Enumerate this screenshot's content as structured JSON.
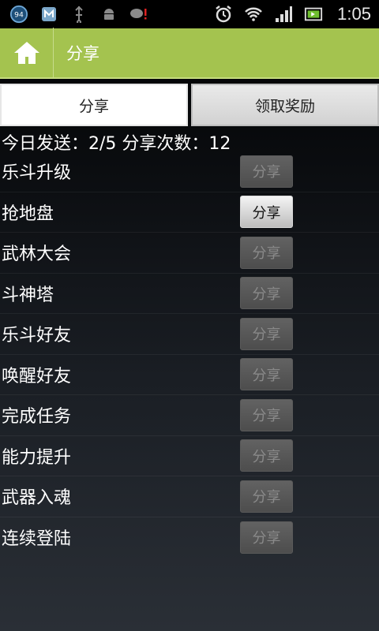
{
  "status_bar": {
    "notification_badge": "94",
    "time": "1:05"
  },
  "header": {
    "title": "分享"
  },
  "tabs": [
    {
      "label": "分享",
      "active": true
    },
    {
      "label": "领取奖励",
      "active": false
    }
  ],
  "stats": {
    "text": "今日发送：2/5 分享次数：12"
  },
  "items": [
    {
      "label": "乐斗升级",
      "button": "分享",
      "enabled": false
    },
    {
      "label": "抢地盘",
      "button": "分享",
      "enabled": true
    },
    {
      "label": "武林大会",
      "button": "分享",
      "enabled": false
    },
    {
      "label": "斗神塔",
      "button": "分享",
      "enabled": false
    },
    {
      "label": "乐斗好友",
      "button": "分享",
      "enabled": false
    },
    {
      "label": "唤醒好友",
      "button": "分享",
      "enabled": false
    },
    {
      "label": "完成任务",
      "button": "分享",
      "enabled": false
    },
    {
      "label": "能力提升",
      "button": "分享",
      "enabled": false
    },
    {
      "label": "武器入魂",
      "button": "分享",
      "enabled": false
    },
    {
      "label": "连续登陆",
      "button": "分享",
      "enabled": false
    }
  ],
  "colors": {
    "header_bg": "#a4c34f",
    "status_bar_bg": "#000000"
  }
}
